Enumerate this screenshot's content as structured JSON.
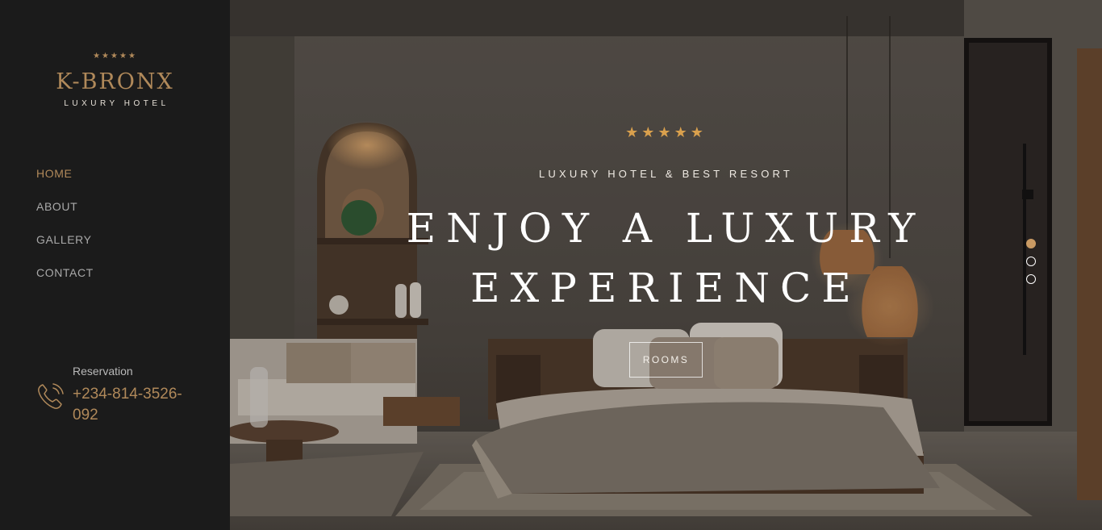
{
  "brand": {
    "stars": "★★★★★",
    "name": "K-BRONX",
    "subtitle": "LUXURY HOTEL"
  },
  "nav": {
    "items": [
      {
        "label": "HOME",
        "active": true
      },
      {
        "label": "ABOUT",
        "active": false
      },
      {
        "label": "GALLERY",
        "active": false
      },
      {
        "label": "CONTACT",
        "active": false
      }
    ]
  },
  "reservation": {
    "label": "Reservation",
    "phone": "+234-814-3526-092",
    "icon": "phone-icon"
  },
  "hero": {
    "stars": "★★★★★",
    "tagline": "LUXURY HOTEL & BEST RESORT",
    "title_line1": "ENJOY A LUXURY",
    "title_line2": "EXPERIENCE",
    "button_label": "ROOMS",
    "slides": {
      "count": 3,
      "active_index": 0
    }
  },
  "colors": {
    "accent": "#b0895a",
    "star": "#d9a04d",
    "sidebar_bg": "#1b1b1b"
  }
}
